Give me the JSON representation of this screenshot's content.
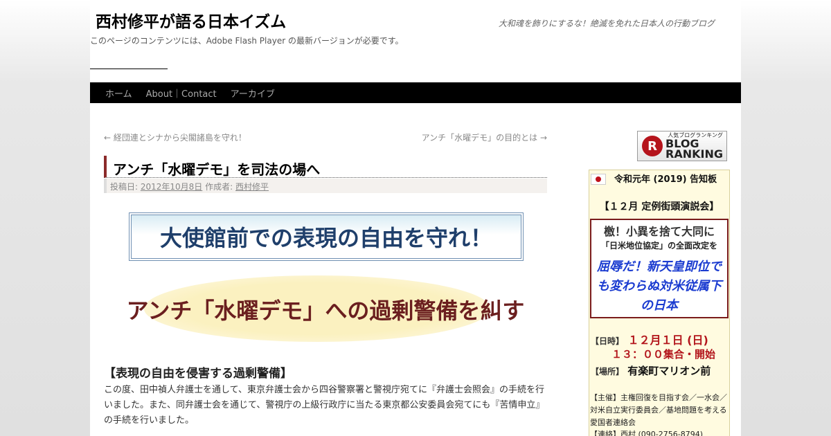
{
  "header": {
    "site_title": "西村修平が語る日本イズム",
    "site_description": "大和魂を飾りにするな！絶滅を免れた日本人の行動ブログ",
    "flash_note": "このページのコンテンツには、Adobe Flash Player の最新バージョンが必要です。"
  },
  "nav": {
    "items": [
      {
        "label": "ホーム"
      },
      {
        "label": "About｜Contact"
      },
      {
        "label": "アーカイブ"
      }
    ]
  },
  "post_nav": {
    "prev": "← 経団連とシナから尖閣諸島を守れ！",
    "next": "アンチ「水曜デモ」の目的とは →"
  },
  "post": {
    "title": "アンチ「水曜デモ」を司法の場へ",
    "meta_prefix": "投稿日: ",
    "date": "2012年10月8日",
    "author_prefix": " 作成者: ",
    "author": "西村修平",
    "banner1": "大使館前での表現の自由を守れ！",
    "banner2": "アンチ「水曜デモ」への過剰警備を糾す",
    "section_heading": "【表現の自由を侵害する過剰警備】",
    "body": "この度、田中禎人弁護士を通して、東京弁護士会から四谷警察署と警視庁宛てに『弁護士会照会』の手続を行いました。また、同弁護士会を通じて、警視庁の上級行政庁に当たる東京都公安委員会宛てにも『苦情申立』の手続を行いました。"
  },
  "sidebar": {
    "ranking_badge": {
      "letter": "R",
      "line1": "BLOG",
      "line2": "RANKING",
      "small": "人気ブログランキング"
    },
    "notice": {
      "title": "令和元年 (2019) 告知板",
      "event": "【１２月 定例街頭演説会】",
      "box_line1": "檄！小異を捨て大同に",
      "box_line2": "「日米地位協定」の全面改定を",
      "box_line3": "屈辱だ！新天皇即位でも変わらぬ対米従属下の日本",
      "date_label": "【日時】",
      "date_value": "１２月１日 (日)",
      "time_value": "１３：００集合・開始",
      "place_label": "【場所】",
      "place_value": "有楽町マリオン前",
      "organizer": "【主催】主権回復を目指す会／一水会／対米自立実行委員会／基地問題を考える愛国者連絡会",
      "contact": "【連絡】西村 (090-2756-8794)"
    }
  }
}
